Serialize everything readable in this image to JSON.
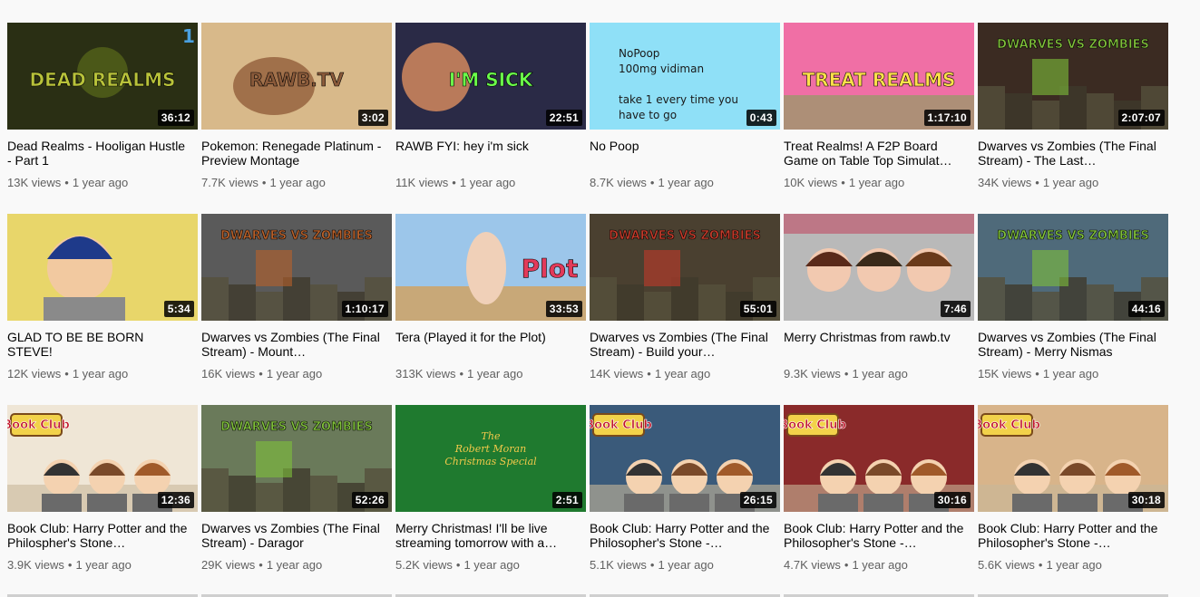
{
  "videos": [
    {
      "title": "Dead Realms - Hooligan Hustle - Part 1",
      "views": "13K views",
      "age": "1 year ago",
      "duration": "36:12",
      "thumb_text": "DEAD REALMS",
      "thumb_badge": "1",
      "bg": "#2a2f14",
      "accent": "#b8c23a"
    },
    {
      "title": "Pokemon: Renegade Platinum - Preview Montage",
      "views": "7.7K views",
      "age": "1 year ago",
      "duration": "3:02",
      "thumb_text": "RAWB.TV",
      "bg": "#d8b98a",
      "accent": "#8a5a3a"
    },
    {
      "title": "RAWB FYI: hey i'm sick",
      "views": "11K views",
      "age": "1 year ago",
      "duration": "22:51",
      "thumb_text": "I'M SICK",
      "bg": "#2a2a46",
      "accent": "#6bff4a"
    },
    {
      "title": "No Poop",
      "views": "8.7K views",
      "age": "1 year ago",
      "duration": "0:43",
      "thumb_lines": [
        "NoPoop",
        "100mg vidiman",
        "",
        "take 1 every time you",
        "have to go"
      ],
      "bg": "#8fe0f7",
      "accent": "#1a1a1a"
    },
    {
      "title": "Treat Realms! A F2P Board Game on Table Top Simulat…",
      "views": "10K views",
      "age": "1 year ago",
      "duration": "1:17:10",
      "thumb_text": "TREAT REALMS",
      "bg": "#f06fa5",
      "accent": "#ffe24a"
    },
    {
      "title": "Dwarves vs Zombies (The Final Stream) - The Last…",
      "views": "34K views",
      "age": "1 year ago",
      "duration": "2:07:07",
      "thumb_text": "DWARVES VS ZOMBIES",
      "bg": "#3b2b22",
      "accent": "#7fbf3a"
    },
    {
      "title": "GLAD TO BE BE BORN STEVE!",
      "views": "12K views",
      "age": "1 year ago",
      "duration": "5:34",
      "bg": "#e8d66a",
      "accent": "#1e3a8a"
    },
    {
      "title": "Dwarves vs Zombies (The Final Stream) - Mount…",
      "views": "16K views",
      "age": "1 year ago",
      "duration": "1:10:17",
      "thumb_text": "DWARVES VS ZOMBIES",
      "bg": "#5a5a5a",
      "accent": "#b8602a"
    },
    {
      "title": "Tera (Played it for the Plot)",
      "views": "313K views",
      "age": "1 year ago",
      "duration": "33:53",
      "thumb_text": "Plot",
      "bg": "#9cc6ea",
      "accent": "#e23a5a"
    },
    {
      "title": "Dwarves vs Zombies (The Final Stream) - Build your…",
      "views": "14K views",
      "age": "1 year ago",
      "duration": "55:01",
      "thumb_text": "DWARVES VS ZOMBIES",
      "bg": "#4a4030",
      "accent": "#c23a2a"
    },
    {
      "title": "Merry Christmas from rawb.tv",
      "views": "9.3K views",
      "age": "1 year ago",
      "duration": "7:46",
      "bg": "#b9b9b9",
      "accent": "#c2143a"
    },
    {
      "title": "Dwarves vs Zombies (The Final Stream) - Merry Nismas",
      "views": "15K views",
      "age": "1 year ago",
      "duration": "44:16",
      "thumb_text": "DWARVES VS ZOMBIES",
      "bg": "#4f6a7a",
      "accent": "#7fbf3a"
    },
    {
      "title": "Book Club: Harry Potter and the Philospher's Stone…",
      "views": "3.9K views",
      "age": "1 year ago",
      "duration": "12:36",
      "thumb_text": "Book Club",
      "bg": "#efe6d6",
      "accent": "#c0142a"
    },
    {
      "title": "Dwarves vs Zombies (The Final Stream) - Daragor",
      "views": "29K views",
      "age": "1 year ago",
      "duration": "52:26",
      "thumb_text": "DWARVES VS ZOMBIES",
      "bg": "#6a7a5a",
      "accent": "#7fbf3a"
    },
    {
      "title": "Merry Christmas! I'll be live streaming tomorrow with a…",
      "views": "5.2K views",
      "age": "1 year ago",
      "duration": "2:51",
      "thumb_lines": [
        "The",
        "Robert Moran",
        "Christmas Special"
      ],
      "bg": "#1f7a2f",
      "accent": "#f2c94a"
    },
    {
      "title": "Book Club: Harry Potter and the Philosopher's Stone -…",
      "views": "5.1K views",
      "age": "1 year ago",
      "duration": "26:15",
      "thumb_text": "Book Club",
      "bg": "#3a5a7a",
      "accent": "#c0142a"
    },
    {
      "title": "Book Club: Harry Potter and the Philosopher's Stone -…",
      "views": "4.7K views",
      "age": "1 year ago",
      "duration": "30:16",
      "thumb_text": "Book Club",
      "bg": "#8a2a2a",
      "accent": "#c0142a"
    },
    {
      "title": "Book Club: Harry Potter and the Philosopher's Stone -…",
      "views": "5.6K views",
      "age": "1 year ago",
      "duration": "30:18",
      "thumb_text": "Book Club",
      "bg": "#d8b48a",
      "accent": "#c0142a"
    }
  ]
}
